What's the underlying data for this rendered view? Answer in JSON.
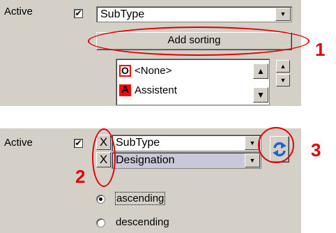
{
  "top": {
    "active_label": "Active",
    "active_checked": "✔",
    "subtype_value": "SubType",
    "add_sorting_label": "Add sorting",
    "list_items": [
      {
        "badge": "O",
        "badge_color": "#ff0000",
        "label": "<None>"
      },
      {
        "badge": "A",
        "badge_color": "#ff0000",
        "label": "Assistent"
      }
    ]
  },
  "bottom": {
    "active_label": "Active",
    "active_checked": "✔",
    "sort_rows": [
      {
        "remove_label": "X",
        "value": "SubType"
      },
      {
        "remove_label": "X",
        "value": "Designation"
      }
    ],
    "order_options": [
      {
        "label": "ascending",
        "selected": true
      },
      {
        "label": "descending",
        "selected": false
      }
    ]
  },
  "callouts": {
    "one": "1",
    "two": "2",
    "three": "3",
    "color": "#e00000"
  },
  "icons": {
    "dropdown": "chevron-down-icon",
    "scroll_up": "arrow-up-icon",
    "scroll_down": "arrow-down-icon",
    "swap": "swap-arrows-icon"
  }
}
